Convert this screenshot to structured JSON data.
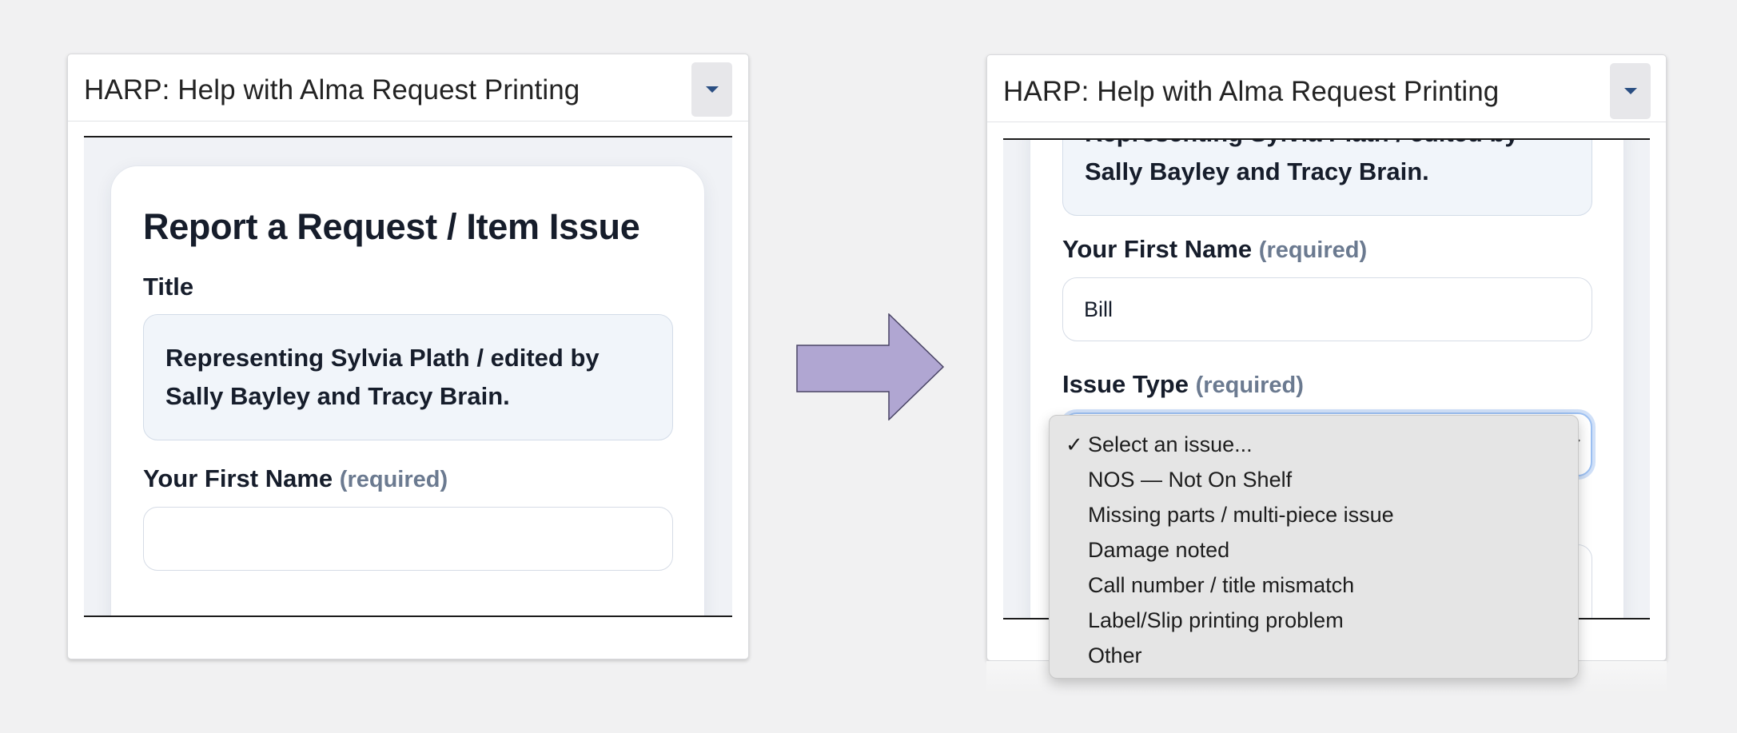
{
  "panel": {
    "title": "HARP: Help with Alma Request Printing"
  },
  "form": {
    "heading": "Report a Request / Item Issue",
    "title_label": "Title",
    "title_value_line1": "Representing Sylvia Plath / edited by",
    "title_value_line2": "Sally Bayley and Tracy Brain.",
    "first_name_label": "Your First Name",
    "issue_type_label": "Issue Type",
    "required_tag": "(required)",
    "first_name_value_before": "",
    "first_name_value_after": "Bill"
  },
  "dropdown": {
    "check_glyph": "✓",
    "options": [
      "Select an issue...",
      "NOS — Not On Shelf",
      "Missing parts / multi-piece issue",
      "Damage noted",
      "Call number / title mismatch",
      "Label/Slip printing problem",
      "Other"
    ],
    "selected_index": 0
  },
  "colors": {
    "arrow_fill": "#b0a6d2",
    "arrow_stroke": "#4a4566",
    "caret": "#2a4e82",
    "required_text": "#6b7a90",
    "title_box_bg": "#f1f5fa"
  },
  "icons": {
    "collapse": "caret-down-icon",
    "transition": "right-arrow-icon",
    "select": "chevron-down-icon",
    "selected": "checkmark-icon"
  }
}
